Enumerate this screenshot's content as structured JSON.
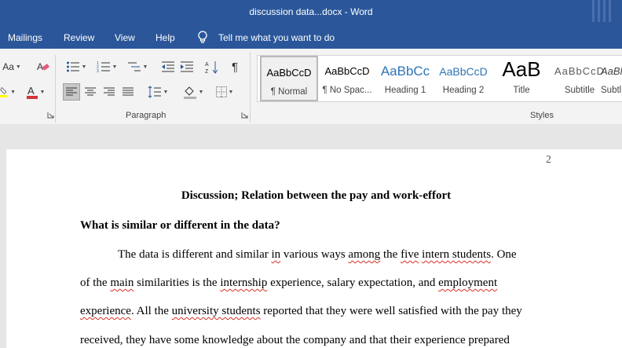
{
  "window": {
    "title": "discussion data...docx  -  Word"
  },
  "menu": {
    "items": [
      "Mailings",
      "Review",
      "View",
      "Help"
    ],
    "tell_me": "Tell me what you want to do"
  },
  "ribbon": {
    "font_partial": "Aa",
    "paragraph_group_label": "Paragraph",
    "styles_group_label": "Styles",
    "pilcrow": "¶",
    "styles": [
      {
        "preview": "AaBbCcD",
        "name": "¶ Normal"
      },
      {
        "preview": "AaBbCcD",
        "name": "¶ No Spac..."
      },
      {
        "preview": "AaBbCc",
        "name": "Heading 1"
      },
      {
        "preview": "AaBbCcD",
        "name": "Heading 2"
      },
      {
        "preview": "AaB",
        "name": "Title"
      },
      {
        "preview": "AaBbCcD",
        "name": "Subtitle"
      },
      {
        "preview": "AaBl",
        "name": "Subtl"
      }
    ],
    "colors": {
      "highlight": "#ffff00",
      "font_color": "#d13438",
      "brand": "#2b579a"
    }
  },
  "document": {
    "page_number": "2",
    "heading": "Discussion; Relation between the pay and work-effort",
    "subheading": "What is similar or different in the data?",
    "lines": [
      [
        {
          "t": "The data is different and similar "
        },
        {
          "t": "in",
          "sq": true
        },
        {
          "t": " various ways "
        },
        {
          "t": "among",
          "sq": true
        },
        {
          "t": " the "
        },
        {
          "t": "five",
          "sq": true
        },
        {
          "t": " "
        },
        {
          "t": "intern students",
          "sq": true
        },
        {
          "t": ". One"
        }
      ],
      [
        {
          "t": "of the "
        },
        {
          "t": "main",
          "sq": true
        },
        {
          "t": " similarities is the "
        },
        {
          "t": "internship",
          "sq": true
        },
        {
          "t": " experience, salary expectation, and "
        },
        {
          "t": "employment",
          "sq": true
        }
      ],
      [
        {
          "t": "experience",
          "sq": true
        },
        {
          "t": ". All the "
        },
        {
          "t": "university students",
          "sq": true
        },
        {
          "t": " reported that they were well satisfied with the pay they"
        }
      ],
      [
        {
          "t": "received, they have some knowledge about the company and that their experience prepared"
        }
      ]
    ]
  }
}
